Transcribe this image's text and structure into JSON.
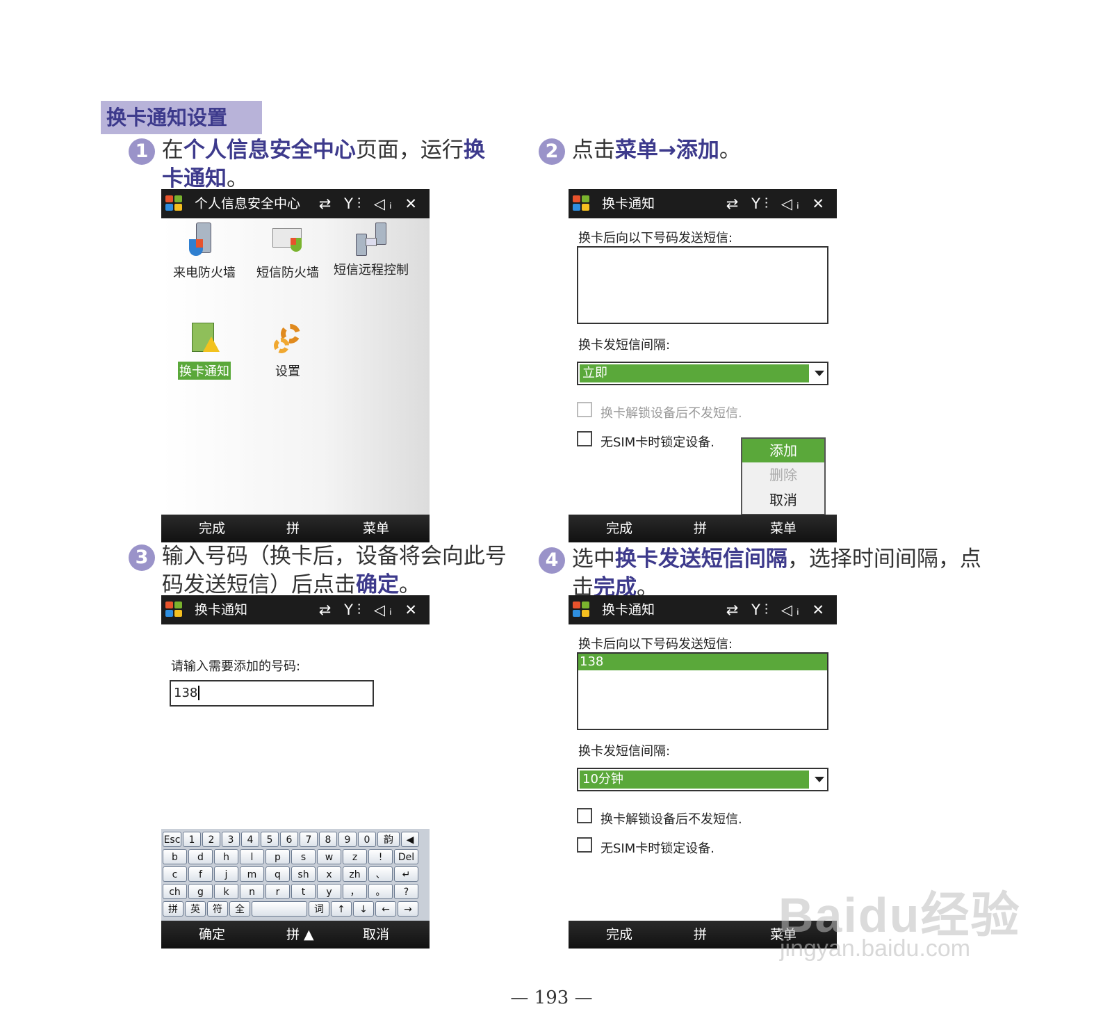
{
  "section_title": "换卡通知设置",
  "steps": {
    "s1": {
      "num": "1",
      "pre": "在",
      "b1": "个人信息安全中心",
      "mid": "页面，运行",
      "b2_line1": "换",
      "b2_line2": "卡通知",
      "end": "。"
    },
    "s2": {
      "num": "2",
      "pre": "点击",
      "b1": "菜单",
      "arrow": "→",
      "b2": "添加",
      "end": "。"
    },
    "s3": {
      "num": "3",
      "line1": "输入号码（换卡后，设备将会向此号",
      "line2_pre": "码发送短信）后点击",
      "b1": "确定",
      "end": "。"
    },
    "s4": {
      "num": "4",
      "pre": "选中",
      "b1": "换卡发送短信间隔",
      "mid": "，选择时间间隔，点",
      "line2_pre": "击",
      "b2": "完成",
      "end": "。"
    }
  },
  "status_icons": "⇄ Y⫶ ◁ᵢ ✕",
  "screen1": {
    "title": "个人信息安全中心",
    "apps": [
      "来电防火墙",
      "短信防火墙",
      "短信远程控制",
      "换卡通知",
      "设置"
    ],
    "softkeys": {
      "left": "完成",
      "center": "拼",
      "right": "菜单"
    }
  },
  "screen2": {
    "title": "换卡通知",
    "label_numbers": "换卡后向以下号码发送短信:",
    "label_interval": "换卡发短信间隔:",
    "interval_value": "立即",
    "chk1": "换卡解锁设备后不发短信.",
    "chk2": "无SIM卡时锁定设备.",
    "menu": [
      "添加",
      "删除",
      "取消"
    ],
    "softkeys": {
      "left": "完成",
      "center": "拼",
      "right": "菜单"
    }
  },
  "screen3": {
    "title": "换卡通知",
    "prompt": "请输入需要添加的号码:",
    "input_value": "138",
    "keyboard": {
      "row1": [
        "Esc",
        "1",
        "2",
        "3",
        "4",
        "5",
        "6",
        "7",
        "8",
        "9",
        "0",
        "韵",
        "◀"
      ],
      "row2": [
        "b",
        "d",
        "h",
        "l",
        "p",
        "s",
        "w",
        "z",
        "!",
        "Del"
      ],
      "row3": [
        "c",
        "f",
        "j",
        "m",
        "q",
        "sh",
        "x",
        "zh",
        "、",
        "↵"
      ],
      "row4": [
        "ch",
        "g",
        "k",
        "n",
        "r",
        "t",
        "y",
        "，",
        "。",
        "?"
      ],
      "row5": [
        "拼",
        "英",
        "符",
        "全",
        " ",
        "词",
        "↑",
        "↓",
        "←",
        "→"
      ]
    },
    "softkeys": {
      "left": "确定",
      "center": "拼 ▲",
      "right": "取消"
    }
  },
  "screen4": {
    "title": "换卡通知",
    "label_numbers": "换卡后向以下号码发送短信:",
    "number_item": "138",
    "label_interval": "换卡发短信间隔:",
    "interval_value": "10分钟",
    "chk1": "换卡解锁设备后不发短信.",
    "chk2": "无SIM卡时锁定设备.",
    "softkeys": {
      "left": "完成",
      "center": "拼",
      "right": "菜单"
    }
  },
  "page_number": "— 193 —",
  "watermark": {
    "logo": "Baidu经验",
    "url": "jingyan.baidu.com"
  },
  "colors": {
    "accent": "#3d3a8c",
    "heading_bg": "#b8b3d9",
    "select_green": "#5aa83a",
    "titlebar": "#1c1c1c"
  }
}
